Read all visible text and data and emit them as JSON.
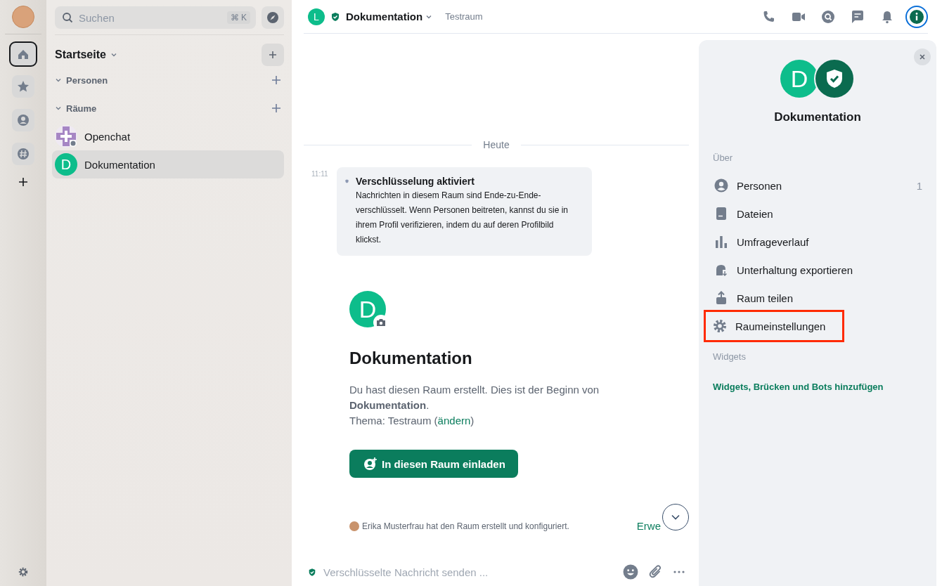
{
  "spaces_bar": {
    "items": [
      {
        "kind": "home",
        "selected": true
      },
      {
        "kind": "favourites",
        "selected": false
      },
      {
        "kind": "people",
        "selected": false
      },
      {
        "kind": "other",
        "selected": false
      }
    ]
  },
  "room_list": {
    "search": {
      "placeholder": "Suchen",
      "shortcut": "⌘ K"
    },
    "title": "Startseite",
    "sections": [
      {
        "label": "Personen",
        "expanded": true
      },
      {
        "label": "Räume",
        "expanded": true,
        "rooms": [
          {
            "name": "Openchat",
            "kind": "image",
            "selected": false
          },
          {
            "name": "Dokumentation",
            "kind": "letter",
            "avatar": "D",
            "selected": true
          }
        ]
      }
    ]
  },
  "header": {
    "avatar": "L",
    "name": "Dokumentation",
    "topic": "Testraum",
    "buttons": [
      {
        "kind": "phone",
        "selected": false
      },
      {
        "kind": "video",
        "selected": false
      },
      {
        "kind": "search",
        "selected": false
      },
      {
        "kind": "threads",
        "selected": false
      },
      {
        "kind": "bell",
        "selected": false
      },
      {
        "kind": "info",
        "selected": true
      }
    ]
  },
  "timeline": {
    "date": "Heute",
    "event": {
      "time": "11:11",
      "title": "Verschlüsselung aktiviert",
      "body": "Nachrichten in diesem Raum sind Ende-zu-Ende-verschlüsselt. Wenn Personen beitreten, kannst du sie in ihrem Profil verifizieren, indem du auf deren Profilbild klickst."
    },
    "intro": {
      "avatar": "D",
      "title": "Dokumentation",
      "text": "Du hast diesen Raum erstellt. Dies ist der Beginn von **Dokumentation**.",
      "topic_prefix": "Thema: Testraum (",
      "topic_link": "ändern",
      "topic_suffix": ")",
      "button": "In diesen Raum einladen"
    },
    "summary": {
      "text": "Erika Musterfrau hat den Raum erstellt und konfiguriert.",
      "link": "Erwe"
    }
  },
  "composer": {
    "placeholder": "Verschlüsselte Nachricht senden ..."
  },
  "right_panel": {
    "avatar": "D",
    "name": "Dokumentation",
    "about": {
      "heading": "Über",
      "items": [
        {
          "kind": "people",
          "label": "Personen",
          "count": "1",
          "highlighted": false
        },
        {
          "kind": "files",
          "label": "Dateien",
          "highlighted": false
        },
        {
          "kind": "polls",
          "label": "Umfrageverlauf",
          "highlighted": false
        },
        {
          "kind": "export",
          "label": "Unterhaltung exportieren",
          "highlighted": false
        },
        {
          "kind": "share",
          "label": "Raum teilen",
          "highlighted": false
        },
        {
          "kind": "settings",
          "label": "Raumeinstellungen",
          "highlighted": true
        }
      ]
    },
    "widgets": {
      "heading": "Widgets",
      "link": "Widgets, Brücken und Bots hinzufügen"
    }
  }
}
